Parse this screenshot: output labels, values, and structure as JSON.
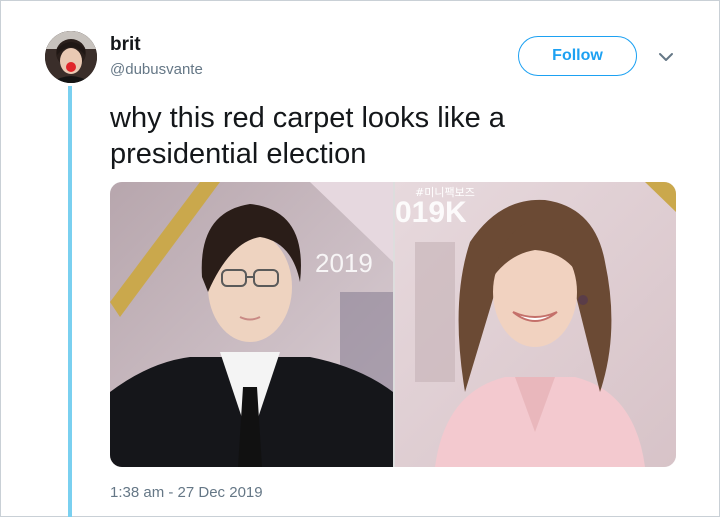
{
  "tweet": {
    "author_name": "brit",
    "author_handle": "@dubusvante",
    "follow_label": "Follow",
    "text_line1": "why this red carpet looks like a",
    "text_line2": "presidential election",
    "timestamp": "1:38 am - 27 Dec 2019",
    "media_text_left": "2019",
    "media_text_right": "#미니팩보즈",
    "media_text_right2": "019K"
  },
  "colors": {
    "accent": "#1da1f2",
    "thread_line": "#7ad0f0",
    "secondary_text": "#657786"
  }
}
